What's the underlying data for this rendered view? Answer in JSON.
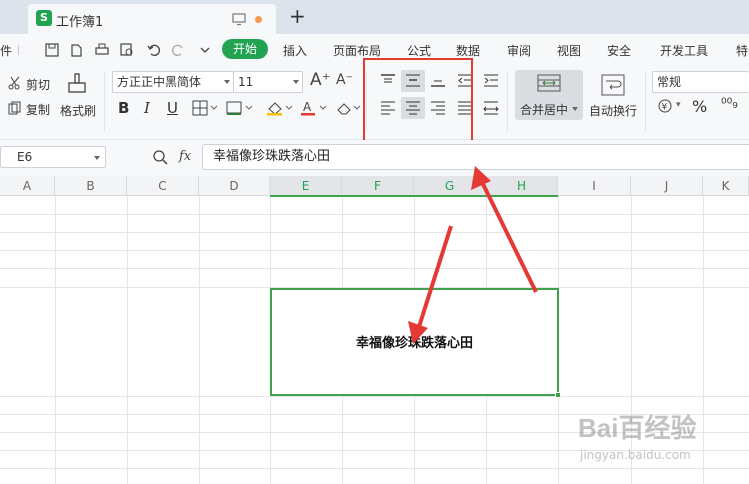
{
  "titlebar": {
    "doc_title": "工作簿1",
    "logo_letter": "S",
    "add_tab": "+"
  },
  "menu": {
    "file_label": "件",
    "start_label": "开始",
    "items": [
      "插入",
      "页面布局",
      "公式",
      "数据",
      "审阅",
      "视图",
      "安全",
      "开发工具",
      "特"
    ]
  },
  "ribbon": {
    "cut_label": "剪切",
    "copy_label": "复制",
    "format_painter_label": "格式刷",
    "font_family": "方正正中黑简体",
    "font_size": "11",
    "merge_center_label": "合并居中",
    "auto_wrap_label": "自动换行",
    "number_format": "常规",
    "currency_symbol": "¥",
    "percent_symbol": "%"
  },
  "formula": {
    "cell_ref": "E6",
    "fx_label": "fx",
    "content": "幸福像珍珠跌落心田"
  },
  "columns": [
    "A",
    "B",
    "C",
    "D",
    "E",
    "F",
    "G",
    "H",
    "I",
    "J",
    "K"
  ],
  "selected_columns": [
    "E",
    "F",
    "G",
    "H"
  ],
  "merged_cell": {
    "text": "幸福像珍珠跌落心田"
  },
  "watermark": {
    "brand": "Bai百经验",
    "url": "jingyan.baidu.com"
  },
  "colors": {
    "accent": "#22a352",
    "selection": "#3fa34d",
    "annotation": "#e53935"
  }
}
